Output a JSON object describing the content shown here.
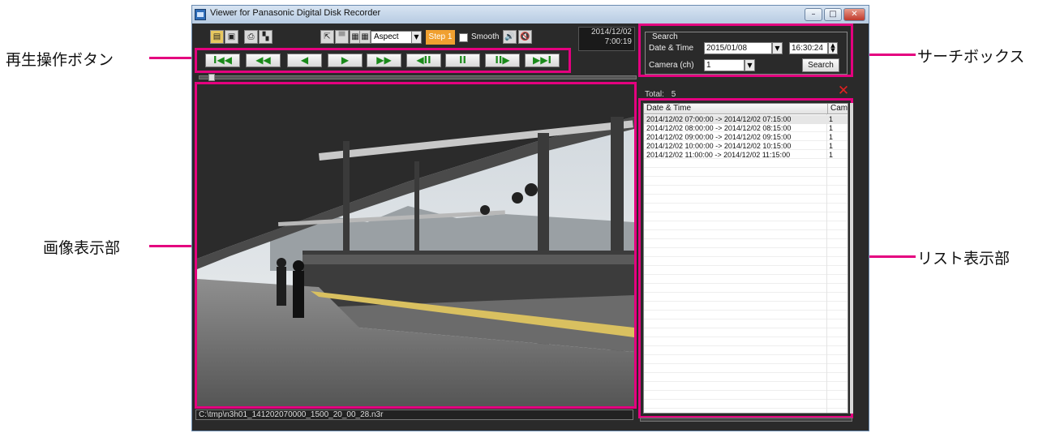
{
  "window": {
    "title": "Viewer for Panasonic Digital Disk Recorder",
    "minimize": "–",
    "maximize": "□",
    "close": "✕"
  },
  "toolbar": {
    "aspect_value": "Aspect",
    "step_label": "Step 1",
    "smooth_label": "Smooth",
    "sound_icon": "🔊",
    "mute_icon": "🔇"
  },
  "clock": {
    "date": "2014/12/02",
    "time": "7:00:19"
  },
  "playback": {
    "buttons": [
      {
        "name": "skip-to-start",
        "glyph": "I◀◀"
      },
      {
        "name": "fast-reverse",
        "glyph": "◀◀"
      },
      {
        "name": "reverse-play",
        "glyph": "◀"
      },
      {
        "name": "play",
        "glyph": "▶"
      },
      {
        "name": "fast-forward",
        "glyph": "▶▶"
      },
      {
        "name": "step-back",
        "glyph": "◀II"
      },
      {
        "name": "pause",
        "glyph": "II"
      },
      {
        "name": "step-forward",
        "glyph": "II▶"
      },
      {
        "name": "skip-to-end",
        "glyph": "▶▶I"
      }
    ]
  },
  "file_path": "C:\\tmp\\n3h01_141202070000_1500_20_00_28.n3r",
  "search": {
    "group_title": "Search",
    "date_time_label": "Date & Time",
    "date_value": "2015/01/08",
    "time_value": "16:30:24",
    "camera_label": "Camera (ch)",
    "camera_value": "1",
    "search_button": "Search"
  },
  "list": {
    "total_label": "Total:",
    "total_value": "5",
    "col_datetime": "Date & Time",
    "col_cam": "Cam",
    "rows": [
      {
        "range": "2014/12/02 07:00:00 -> 2014/12/02 07:15:00",
        "cam": "1"
      },
      {
        "range": "2014/12/02 08:00:00 -> 2014/12/02 08:15:00",
        "cam": "1"
      },
      {
        "range": "2014/12/02 09:00:00 -> 2014/12/02 09:15:00",
        "cam": "1"
      },
      {
        "range": "2014/12/02 10:00:00 -> 2014/12/02 10:15:00",
        "cam": "1"
      },
      {
        "range": "2014/12/02 11:00:00 -> 2014/12/02 11:15:00",
        "cam": "1"
      }
    ]
  },
  "callouts": {
    "playback_buttons": "再生操作ボタン",
    "image_display": "画像表示部",
    "search_box": "サーチボックス",
    "list_display": "リスト表示部"
  },
  "colors": {
    "highlight": "#e4007f",
    "window_bg": "#2a2a2a",
    "play_green": "#1a8a1a",
    "step_orange": "#f0a030"
  }
}
